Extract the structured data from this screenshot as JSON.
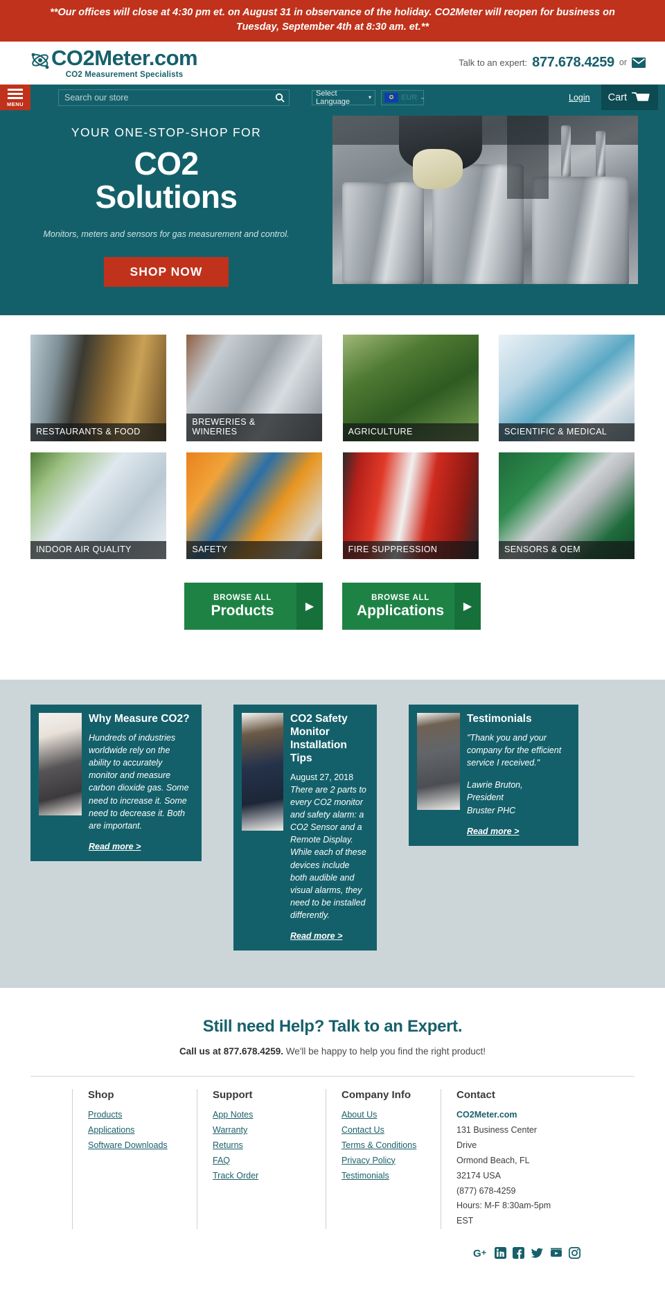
{
  "announcement": {
    "text": "**Our offices will close at 4:30 pm et. on August 31 in observance of the holiday. CO2Meter will reopen for business on Tuesday, September 4th at 8:30 am. et.**"
  },
  "masthead": {
    "logo_main": "CO2Meter.com",
    "logo_sub": "CO2 Measurement Specialists",
    "expert_label": "Talk to an expert:",
    "expert_phone": "877.678.4259",
    "or_text": "or",
    "email_icon": "envelope-icon",
    "logo_icon": "atom-icon"
  },
  "nav": {
    "menu_label": "MENU",
    "search_placeholder": "Search our store",
    "search_value": "",
    "search_icon": "search-icon",
    "language_selected": "Select Language",
    "currency_selected": "EUR",
    "currency_flag": "eu-flag-icon",
    "login_label": "Login",
    "cart_label": "Cart",
    "cart_icon": "cart-icon"
  },
  "hero": {
    "kicker": "YOUR ONE-STOP-SHOP FOR",
    "title_line1": "CO2",
    "title_line2": "Solutions",
    "subtitle": "Monitors, meters and sensors for gas measurement and control.",
    "cta_label": "SHOP NOW"
  },
  "tiles": [
    {
      "label": "RESTAURANTS & FOOD",
      "art": "art-restaurant"
    },
    {
      "label": "BREWERIES &\nWINERIES",
      "art": "art-brewery"
    },
    {
      "label": "AGRICULTURE",
      "art": "art-agri"
    },
    {
      "label": "SCIENTIFIC & MEDICAL",
      "art": "art-sci"
    },
    {
      "label": "INDOOR AIR QUALITY",
      "art": "art-iaq"
    },
    {
      "label": "SAFETY",
      "art": "art-safety"
    },
    {
      "label": "FIRE SUPPRESSION",
      "art": "art-fire"
    },
    {
      "label": "SENSORS & OEM",
      "art": "art-oem"
    }
  ],
  "browse": {
    "kicker": "BROWSE ALL",
    "products_label": "Products",
    "applications_label": "Applications",
    "arrow_icon": "chevron-right-icon"
  },
  "cards": [
    {
      "title": "Why Measure CO2?",
      "date": "",
      "text": "Hundreds of industries worldwide rely on the ability to accurately monitor and measure carbon dioxide gas. Some need to increase it. Some need to decrease it. Both are important.",
      "link": "Read more >"
    },
    {
      "title": "CO2 Safety Monitor Installation Tips",
      "date": "August 27, 2018",
      "text": "There are 2 parts to every CO2 monitor and safety alarm: a CO2 Sensor and a Remote Display. While each of these devices include both audible and visual alarms, they need to be installed differently.",
      "link": "Read more >"
    },
    {
      "title": "Testimonials",
      "quote": "\"Thank you and your company for the efficient service I received.\"",
      "person": "Lawrie Bruton,\nPresident\nBruster PHC",
      "link": "Read more >"
    }
  ],
  "help": {
    "title": "Still need Help? Talk to an Expert.",
    "call_prefix": "Call us at 877.678.4259.",
    "call_suffix": " We'll be happy to help you find the right product!"
  },
  "footer": {
    "columns": [
      {
        "heading": "Shop",
        "links": [
          "Products",
          "Applications",
          "Software Downloads"
        ]
      },
      {
        "heading": "Support",
        "links": [
          "App Notes",
          "Warranty",
          "Returns",
          "FAQ",
          "Track Order"
        ]
      },
      {
        "heading": "Company Info",
        "links": [
          "About Us",
          "Contact Us",
          "Terms & Conditions",
          "Privacy Policy",
          "Testimonials"
        ]
      }
    ],
    "contact": {
      "heading": "Contact",
      "name": "CO2Meter.com",
      "address1": "131 Business Center",
      "address2": "Drive",
      "address3": "Ormond Beach, FL",
      "address4": "32174 USA",
      "phone": "(877) 678-4259",
      "hours1": "Hours: M-F 8:30am-5pm",
      "hours2": "EST"
    },
    "social": [
      {
        "name": "google-plus-icon",
        "glyph": "G+"
      },
      {
        "name": "linkedin-icon",
        "glyph": "in"
      },
      {
        "name": "facebook-icon",
        "glyph": "f"
      },
      {
        "name": "twitter-icon",
        "glyph": "t"
      },
      {
        "name": "youtube-icon",
        "glyph": "yt"
      },
      {
        "name": "instagram-icon",
        "glyph": "ig"
      }
    ]
  },
  "colors": {
    "brand_teal": "#14606a",
    "brand_red": "#c0321b",
    "brand_green": "#1e8245",
    "card_bg": "#ccd6d9"
  }
}
